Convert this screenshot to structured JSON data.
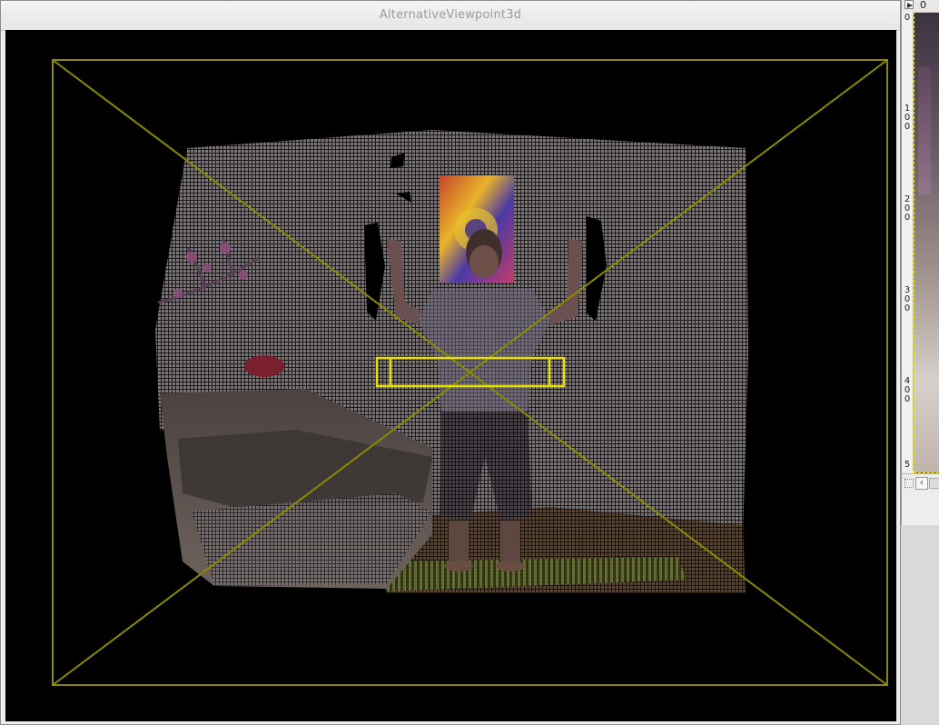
{
  "window": {
    "title": "AlternativeViewpoint3d"
  },
  "background_window": {
    "top_ruler_label": "0",
    "left_ruler_ticks": [
      "0",
      "100",
      "200",
      "300",
      "400",
      "5"
    ],
    "scroll_left_glyph": "‹"
  },
  "icons": {
    "play": "play-icon",
    "corner": "zoom-corner-icon",
    "scroll_left": "chevron-left-icon"
  },
  "colors": {
    "frustum": "#8b8a00",
    "bbox": "#e6e000",
    "viewport_bg": "#000000",
    "title_text": "#9a9a9a"
  }
}
